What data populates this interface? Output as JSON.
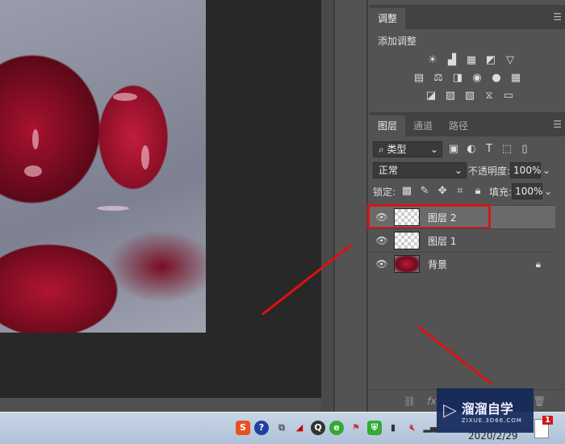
{
  "adjustments": {
    "tab": "调整",
    "title": "添加调整",
    "row1": [
      "brightness-icon",
      "levels-icon",
      "curves-icon",
      "exposure-icon",
      "vibrance-icon"
    ],
    "row2": [
      "hue-saturation-icon",
      "color-balance-icon",
      "black-white-icon",
      "photo-filter-icon",
      "channel-mixer-icon",
      "color-lookup-icon"
    ],
    "row3": [
      "invert-icon",
      "posterize-icon",
      "threshold-icon",
      "selective-color-icon",
      "gradient-map-icon"
    ]
  },
  "layers_panel": {
    "tabs": [
      "图层",
      "通道",
      "路径"
    ],
    "filter_kind": "类型",
    "blend_mode": "正常",
    "opacity_label": "不透明度:",
    "opacity": "100%",
    "lock_label": "锁定:",
    "fill_label": "填充:",
    "fill": "100%",
    "layers": [
      {
        "name": "图层 2",
        "selected": true,
        "visible": true
      },
      {
        "name": "图层 1",
        "selected": false,
        "visible": true
      },
      {
        "name": "背景",
        "selected": false,
        "visible": true,
        "locked": true
      }
    ],
    "footer_fx": "fx"
  },
  "watermark": {
    "brand": "溜溜自学",
    "url": "ZIXUE.3D66.COM"
  },
  "taskbar": {
    "date": "2020/2/29",
    "notification_count": "1"
  },
  "colors": {
    "highlight": "#d01818",
    "arrow": "#e01010"
  }
}
